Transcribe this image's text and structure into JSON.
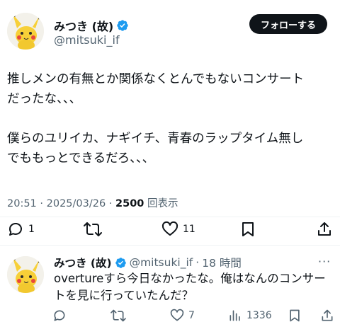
{
  "tweet": {
    "author": {
      "display_name": "みつき (故)",
      "handle": "@mitsuki_if",
      "verified": true,
      "avatar_icon": "pikachu-avatar-icon"
    },
    "follow_button_label": "フォローする",
    "text_lines": [
      "推しメンの有無とか関係なくとんでもないコンサート",
      "だったな、、、",
      "",
      "僕らのユリイカ、ナギイチ、青春のラップタイム無し",
      "でももっとできるだろ、、、"
    ],
    "timestamp": "20:51 · 2025/03/26 · ",
    "views_count": "2500",
    "views_label": " 回表示",
    "actions": {
      "reply_count": "1",
      "retweet_count": "",
      "like_count": "11",
      "bookmark_label": "",
      "share_label": ""
    }
  },
  "reply": {
    "author": {
      "display_name": "みつき (故)",
      "handle": "@mitsuki_if",
      "verified": true
    },
    "separator": "·",
    "time_ago": "18 時間",
    "more_label": "···",
    "text_lines": [
      "overtureすら今日なかったな。俺はなんのコンサー",
      "トを見に行っていたんだ？"
    ],
    "actions": {
      "reply_count": "",
      "retweet_count": "",
      "like_count": "7",
      "views_count": "1336"
    }
  },
  "colors": {
    "text_primary": "#0f1419",
    "text_secondary": "#536471",
    "verified_blue": "#1d9bf0",
    "divider": "#eff3f4"
  }
}
